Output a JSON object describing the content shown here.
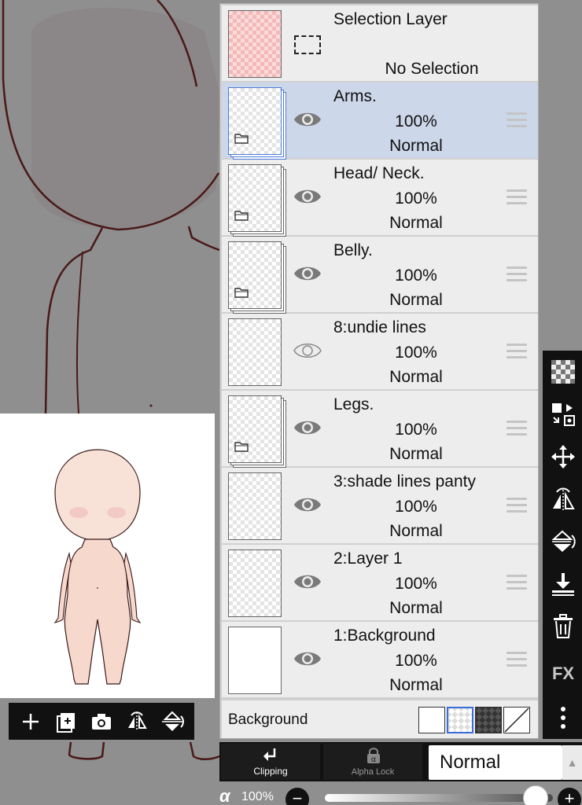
{
  "layers": {
    "selection": {
      "title": "Selection Layer",
      "status": "No Selection"
    },
    "items": [
      {
        "name": "Arms.",
        "opacity": "100%",
        "blend": "Normal",
        "folder": true,
        "visible": true,
        "selected": true
      },
      {
        "name": "Head/ Neck.",
        "opacity": "100%",
        "blend": "Normal",
        "folder": true,
        "visible": true,
        "selected": false
      },
      {
        "name": "Belly.",
        "opacity": "100%",
        "blend": "Normal",
        "folder": true,
        "visible": true,
        "selected": false
      },
      {
        "name": "8:undie lines",
        "opacity": "100%",
        "blend": "Normal",
        "folder": false,
        "visible": false,
        "selected": false
      },
      {
        "name": "Legs.",
        "opacity": "100%",
        "blend": "Normal",
        "folder": true,
        "visible": true,
        "selected": false
      },
      {
        "name": "3:shade lines panty",
        "opacity": "100%",
        "blend": "Normal",
        "folder": false,
        "visible": true,
        "selected": false
      },
      {
        "name": "2:Layer 1",
        "opacity": "100%",
        "blend": "Normal",
        "folder": false,
        "visible": true,
        "selected": false
      },
      {
        "name": "1:Background",
        "opacity": "100%",
        "blend": "Normal",
        "folder": false,
        "visible": true,
        "selected": false
      }
    ],
    "background_label": "Background"
  },
  "right_toolbar": {
    "icons": [
      "checkerboard-icon",
      "transform-layer-icon",
      "move-icon",
      "flip-horizontal-icon",
      "flip-vertical-icon",
      "merge-down-icon",
      "trash-icon",
      "fx-icon",
      "more-icon"
    ],
    "fx_label": "FX"
  },
  "preview_toolbar": {
    "icons": [
      "plus-icon",
      "add-layer-icon",
      "camera-icon",
      "flip-horizontal-icon",
      "flip-vertical-icon"
    ]
  },
  "bottom_bar": {
    "clipping_label": "Clipping",
    "alpha_lock_label": "Alpha Lock",
    "blend_mode": "Normal"
  },
  "opacity": {
    "symbol": "α",
    "value": "100%",
    "level": 1.0,
    "minus": "−",
    "plus": "+"
  },
  "colors": {
    "selected_row": "#cdd7ea",
    "panel_row": "#ededed",
    "toolbar": "#111111",
    "outline": "#5a1a1a",
    "skin": "#f6d8cc"
  }
}
